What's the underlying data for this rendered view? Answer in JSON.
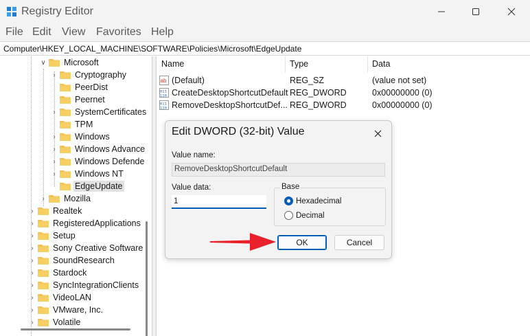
{
  "window": {
    "title": "Registry Editor",
    "minimize_icon": "minimize-icon",
    "maximize_icon": "maximize-icon",
    "close_icon": "close-icon"
  },
  "menu": [
    "File",
    "Edit",
    "View",
    "Favorites",
    "Help"
  ],
  "address": "Computer\\HKEY_LOCAL_MACHINE\\SOFTWARE\\Policies\\Microsoft\\EdgeUpdate",
  "tree": {
    "items": [
      {
        "label": "Microsoft",
        "expanded": true
      },
      {
        "label": "Cryptography",
        "expanded": false
      },
      {
        "label": "PeerDist",
        "expanded": false
      },
      {
        "label": "Peernet",
        "expanded": false
      },
      {
        "label": "SystemCertificates",
        "expanded": false
      },
      {
        "label": "TPM",
        "expanded": false
      },
      {
        "label": "Windows",
        "expanded": false
      },
      {
        "label": "Windows Advance",
        "expanded": false
      },
      {
        "label": "Windows Defende",
        "expanded": false
      },
      {
        "label": "Windows NT",
        "expanded": false
      },
      {
        "label": "EdgeUpdate",
        "expanded": false,
        "selected": true
      },
      {
        "label": "Mozilla",
        "expanded": false
      },
      {
        "label": "Realtek",
        "expanded": false
      },
      {
        "label": "RegisteredApplications",
        "expanded": false
      },
      {
        "label": "Setup",
        "expanded": false
      },
      {
        "label": "Sony Creative Software",
        "expanded": false
      },
      {
        "label": "SoundResearch",
        "expanded": false
      },
      {
        "label": "Stardock",
        "expanded": false
      },
      {
        "label": "SyncIntegrationClients",
        "expanded": false
      },
      {
        "label": "VideoLAN",
        "expanded": false
      },
      {
        "label": "VMware, Inc.",
        "expanded": false
      },
      {
        "label": "Volatile",
        "expanded": false
      }
    ]
  },
  "list": {
    "headers": {
      "name": "Name",
      "type": "Type",
      "data": "Data"
    },
    "rows": [
      {
        "name": "(Default)",
        "type": "REG_SZ",
        "data": "(value not set)",
        "icon": "string-value-icon"
      },
      {
        "name": "CreateDesktopShortcutDefault",
        "type": "REG_DWORD",
        "data": "0x00000000 (0)",
        "icon": "binary-value-icon"
      },
      {
        "name": "RemoveDesktopShortcutDef...",
        "type": "REG_DWORD",
        "data": "0x00000000 (0)",
        "icon": "binary-value-icon"
      }
    ]
  },
  "dialog": {
    "title": "Edit DWORD (32-bit) Value",
    "value_name_label": "Value name:",
    "value_name": "RemoveDesktopShortcutDefault",
    "value_data_label": "Value data:",
    "value_data": "1",
    "base_label": "Base",
    "hex_label": "Hexadecimal",
    "dec_label": "Decimal",
    "base_selected": "Hexadecimal",
    "ok_label": "OK",
    "cancel_label": "Cancel"
  },
  "colors": {
    "accent": "#005fb8",
    "annotation_arrow": "#e8212a",
    "folder": "#f2c14e"
  }
}
